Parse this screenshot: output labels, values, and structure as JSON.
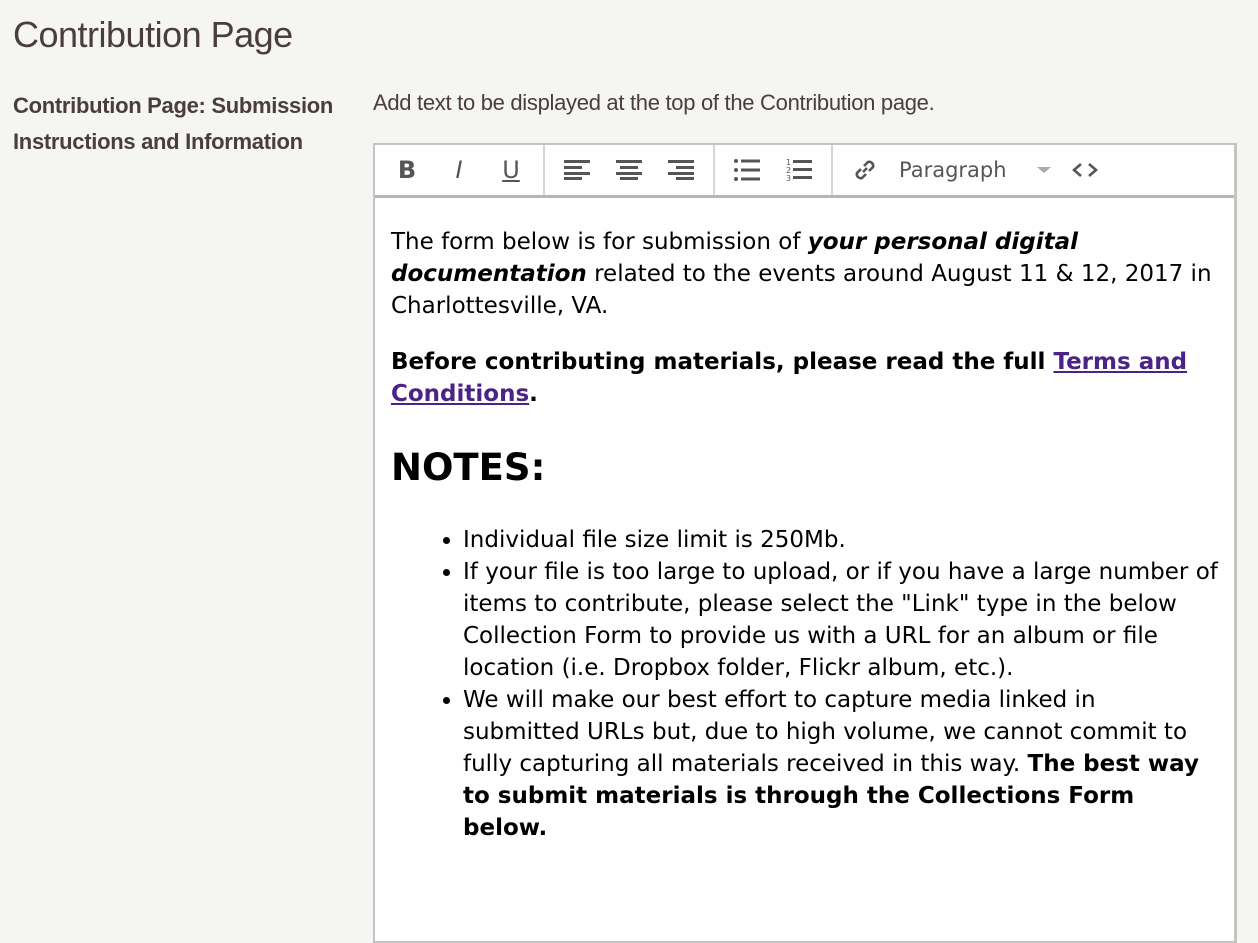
{
  "page": {
    "title": "Contribution Page"
  },
  "field": {
    "label": "Contribution Page: Submission Instructions and Information",
    "help": "Add text to be displayed at the top of the Contribution page."
  },
  "toolbar": {
    "bold": "B",
    "italic": "I",
    "underline": "U",
    "format_select": "Paragraph",
    "icons": [
      "bold-icon",
      "italic-icon",
      "underline-icon",
      "align-left-icon",
      "align-center-icon",
      "align-right-icon",
      "bullet-list-icon",
      "numbered-list-icon",
      "link-icon",
      "code-icon"
    ]
  },
  "content": {
    "p1_a": "The form below is for submission of ",
    "p1_em": "your personal digital documentation",
    "p1_b": " related to the events around August 11 & 12, 2017 in Charlottesville, VA.",
    "p2_a": "Before contributing materials, please read the full ",
    "p2_link": "Terms and Conditions",
    "p2_b": ".",
    "heading": "NOTES:",
    "notes": [
      "Individual file size limit is 250Mb.",
      "If your file is too large to upload, or if you have a large number of items to contribute, please select the \"Link\" type in the below Collection Form to provide us with a URL for an album or file location (i.e. Dropbox folder, Flickr album, etc.).",
      "We will make our best effort to capture media linked in submitted URLs but, due to high volume, we cannot commit to fully capturing all materials received in this way. "
    ],
    "note3_bold": "The best way to submit materials is through the Collections Form below."
  },
  "colors": {
    "link": "#4b2386",
    "background": "#f5f5f1",
    "text": "#4a3d3d"
  }
}
